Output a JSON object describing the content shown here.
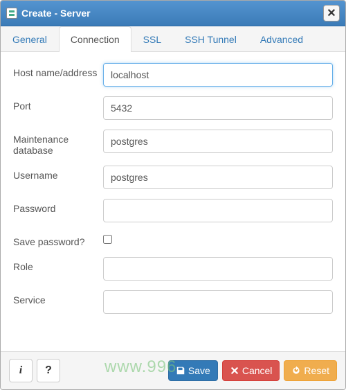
{
  "title": "Create - Server",
  "tabs": [
    {
      "label": "General"
    },
    {
      "label": "Connection"
    },
    {
      "label": "SSL"
    },
    {
      "label": "SSH Tunnel"
    },
    {
      "label": "Advanced"
    }
  ],
  "active_tab": 1,
  "fields": {
    "host": {
      "label": "Host name/address",
      "value": "localhost"
    },
    "port": {
      "label": "Port",
      "value": "5432"
    },
    "maintenance_db": {
      "label": "Maintenance database",
      "value": "postgres"
    },
    "username": {
      "label": "Username",
      "value": "postgres"
    },
    "password": {
      "label": "Password",
      "value": ""
    },
    "save_password": {
      "label": "Save password?",
      "checked": false
    },
    "role": {
      "label": "Role",
      "value": ""
    },
    "service": {
      "label": "Service",
      "value": ""
    }
  },
  "footer": {
    "info_label": "i",
    "help_label": "?",
    "save_label": "Save",
    "cancel_label": "Cancel",
    "reset_label": "Reset"
  },
  "watermark": "www.996"
}
